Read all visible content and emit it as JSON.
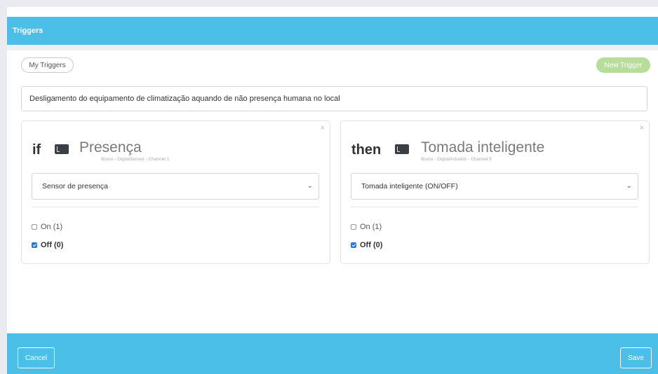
{
  "header": {
    "title": "Triggers"
  },
  "toolbar": {
    "my_triggers_label": "My Triggers",
    "new_trigger_label": "New Trigger"
  },
  "description": {
    "value": "Desligamento do equipamento de climatização aquando de não presença humana no local"
  },
  "if_card": {
    "keyword": "if",
    "close": "×",
    "device_icon": "device-chip-icon",
    "device_name": "Presença",
    "device_meta": "Bruno - DigitalSensor - Channel 1",
    "select_value": "Sensor de presença",
    "options": [
      {
        "label": "On (1)",
        "checked": false
      },
      {
        "label": "Off (0)",
        "checked": true
      }
    ]
  },
  "then_card": {
    "keyword": "then",
    "close": "×",
    "device_icon": "device-chip-icon",
    "device_name": "Tomada inteligente",
    "device_meta": "Bruno - DigitalActuator - Channel 9",
    "select_value": "Tomada inteligente (ON/OFF)",
    "options": [
      {
        "label": "On (1)",
        "checked": false
      },
      {
        "label": "Off (0)",
        "checked": true
      }
    ]
  },
  "footer": {
    "cancel_label": "Cancel",
    "save_label": "Save"
  },
  "colors": {
    "accent": "#4bbfe8",
    "new_trigger": "#b6dd99",
    "checkbox": "#2b77d9"
  }
}
